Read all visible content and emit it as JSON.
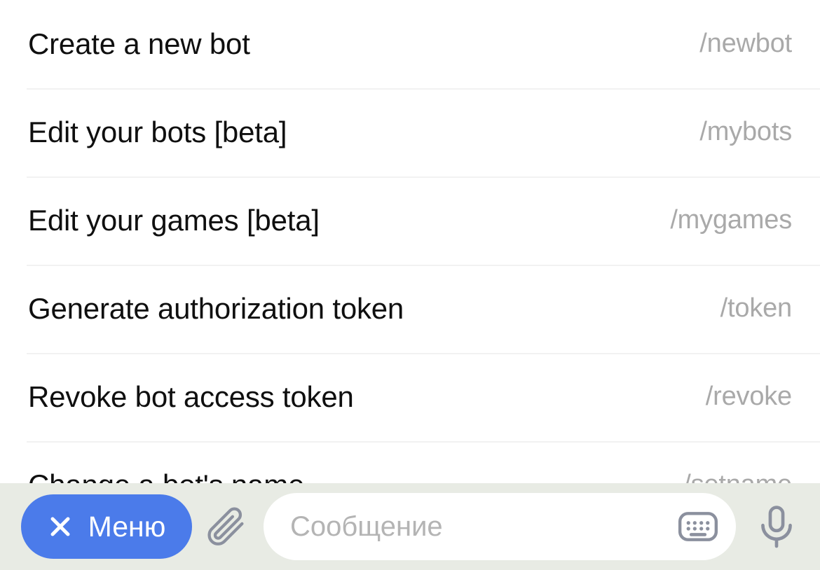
{
  "command_list": {
    "name": "bot-command-list",
    "items": [
      {
        "title": "Create a new bot",
        "slug": "/newbot"
      },
      {
        "title": "Edit your bots [beta]",
        "slug": "/mybots"
      },
      {
        "title": "Edit your games [beta]",
        "slug": "/mygames"
      },
      {
        "title": "Generate authorization token",
        "slug": "/token"
      },
      {
        "title": "Revoke bot access token",
        "slug": "/revoke"
      },
      {
        "title": "Change a bot's name",
        "slug": "/setname"
      }
    ]
  },
  "composer": {
    "menu_button": {
      "label": "Меню",
      "icon": "close-icon",
      "background_color": "#4b7bea",
      "text_color": "#ffffff"
    },
    "attach_icon": "paperclip-icon",
    "message_input": {
      "value": "",
      "placeholder": "Сообщение"
    },
    "keyboard_icon": "keyboard-icon",
    "voice_icon": "microphone-icon",
    "background_color": "#e8ebe4"
  },
  "colors": {
    "page_background": "#ffffff",
    "title_text": "#0f0f0f",
    "slug_text": "#a9a9a9",
    "divider": "#f2f2f2",
    "icon": "#8b909e",
    "placeholder": "#b4b4b4"
  }
}
